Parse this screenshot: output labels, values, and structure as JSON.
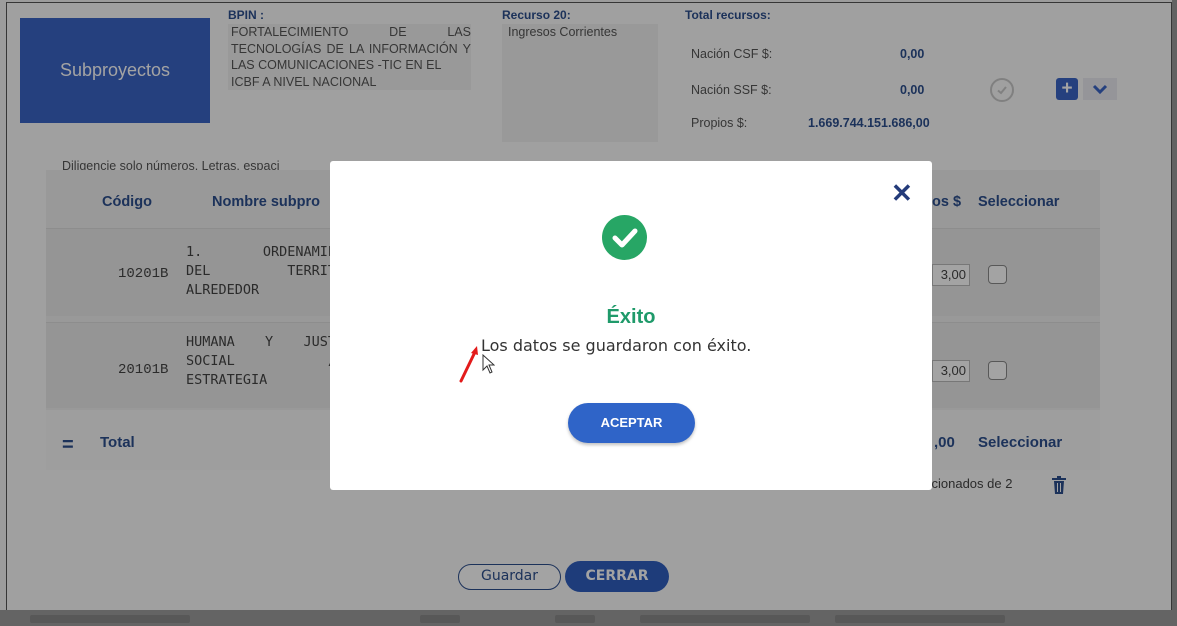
{
  "header": {
    "subproyectos_label": "Subproyectos",
    "bpin_label": "BPIN :",
    "bpin_lines": [
      "FORTALECIMIENTO DE LAS",
      "TECNOLOGÍAS DE LA",
      "INFORMACIÓN Y LAS",
      "COMUNICACIONES -TIC EN EL",
      "ICBF A NIVEL NACIONAL"
    ],
    "recurso_label": "Recurso 20:",
    "recurso_value": "Ingresos Corrientes",
    "total_label": "Total recursos:",
    "totals": [
      {
        "label": "Nación CSF $:",
        "value": "0,00"
      },
      {
        "label": "Nación SSF $:",
        "value": "0,00"
      },
      {
        "label": "Propios $:",
        "value": "1.669.744.151.686,00"
      }
    ],
    "plus_icon": "+"
  },
  "hint_text": "Diligencie solo números. Letras, espaci",
  "table": {
    "headers": {
      "codigo": "Código",
      "nombre": "Nombre subpro",
      "propios": "os $",
      "seleccionar": "Seleccionar"
    },
    "rows": [
      {
        "codigo": "10201B",
        "nombre_lines": [
          "1. ORDENAMIE",
          "DEL TERRIT",
          "ALREDEDOR"
        ],
        "value": "3,00"
      },
      {
        "codigo": "20101B",
        "nombre_lines": [
          "HUMANA Y JUST",
          "SOCIAL /",
          "ESTRATEGIA"
        ],
        "value": "3,00"
      }
    ],
    "total_label": "Total",
    "total_value": ",00",
    "total_seleccionar": "Seleccionar",
    "selected_count": "ccionados de 2"
  },
  "footer": {
    "guardar": "Guardar",
    "cerrar": "CERRAR"
  },
  "modal": {
    "close_symbol": "✕",
    "title": "Éxito",
    "message": "Los datos se guardaron con éxito.",
    "accept_label": "ACEPTAR",
    "success_color": "#27a665"
  },
  "colors": {
    "primary": "#3b64c6",
    "heading": "#2d4f8e",
    "success": "#1f9a6a"
  }
}
